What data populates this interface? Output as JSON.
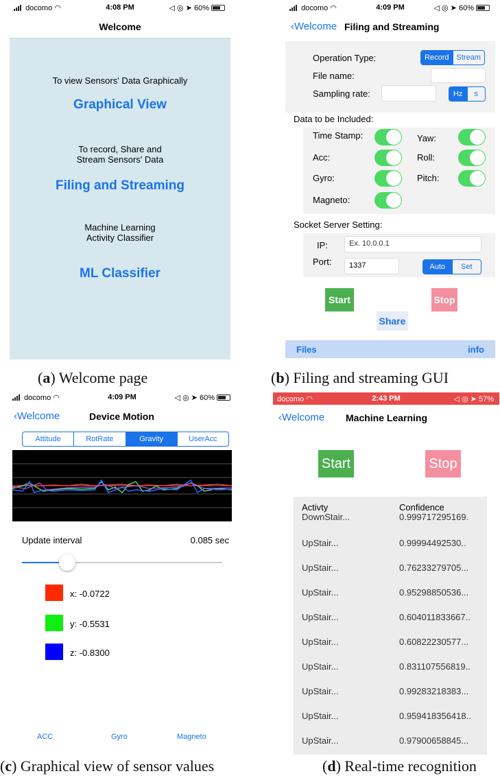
{
  "status_a": {
    "carrier": "docomo",
    "time": "4:08 PM",
    "battery": "60%"
  },
  "status_b": {
    "carrier": "docomo",
    "time": "4:09 PM",
    "battery": "60%"
  },
  "status_c": {
    "carrier": "docomo",
    "time": "4:09 PM",
    "battery": "60%"
  },
  "status_d": {
    "carrier": "docomo",
    "time": "2:43 PM",
    "battery": "57%"
  },
  "colors": {
    "accent": "#1a73e8",
    "switch_on": "#4cd964",
    "start": "#4caf50",
    "stop": "#f48fa0",
    "welcome_bg": "#d6e8ee",
    "status_red": "#e84a4a"
  },
  "welcome": {
    "title": "Welcome",
    "graphical_desc": "To view Sensors' Data Graphically",
    "graphical_button": "Graphical View",
    "filing_desc_1": "To record, Share and",
    "filing_desc_2": "Stream Sensors' Data",
    "filing_button": "Filing and Streaming",
    "ml_desc_1": "Machine Learning",
    "ml_desc_2": "Activity Classifier",
    "ml_button": "ML Classifier"
  },
  "filing": {
    "back": "Welcome",
    "title": "Filing and Streaming",
    "operation_label": "Operation Type:",
    "op_record": "Record",
    "op_stream": "Stream",
    "file_label": "File name:",
    "sampling_label": "Sampling rate:",
    "unit_hz": "Hz",
    "unit_s": "s",
    "data_label": "Data to be Included:",
    "timestamp": "Time Stamp:",
    "acc": "Acc:",
    "gyro": "Gyro:",
    "magneto": "Magneto:",
    "yaw": "Yaw:",
    "roll": "Roll:",
    "pitch": "Pitch:",
    "socket_label": "Socket Server Setting:",
    "ip_label": "IP:",
    "ip_placeholder": "Ex. 10.0.0.1",
    "port_label": "Port:",
    "port_value": "1337",
    "auto": "Auto",
    "set": "Set",
    "start": "Start",
    "stop": "Stop",
    "share": "Share",
    "files": "Files",
    "info": "info"
  },
  "graph": {
    "back": "Welcome",
    "title": "Device Motion",
    "tabs": [
      "Attitude",
      "RotRate",
      "Gravity",
      "UserAcc"
    ],
    "selected_tab": "Gravity",
    "interval_label": "Update interval",
    "interval_value": "0.085 sec",
    "slider_fraction": 0.2,
    "x": "x: -0.0722",
    "y": "y: -0.5531",
    "z": "z: -0.8300",
    "bottom_tabs": [
      "ACC",
      "Gyro",
      "Magneto"
    ]
  },
  "ml": {
    "back": "Welcome",
    "title": "Machine Learning",
    "start": "Start",
    "stop": "Stop",
    "col_activity": "Activty",
    "col_confidence": "Confidence",
    "rows": [
      {
        "activity": "DownStair...",
        "confidence": "0.999717295169."
      },
      {
        "activity": "UpStair...",
        "confidence": "0.99994492530.."
      },
      {
        "activity": "UpStair...",
        "confidence": "0.76233279705..."
      },
      {
        "activity": "UpStair...",
        "confidence": "0.95298850536..."
      },
      {
        "activity": "UpStair...",
        "confidence": "0.604011833667.."
      },
      {
        "activity": "UpStair...",
        "confidence": "0.60822230577..."
      },
      {
        "activity": "UpStair...",
        "confidence": "0.831107556819.."
      },
      {
        "activity": "UpStair...",
        "confidence": "0.99283218383..."
      },
      {
        "activity": "UpStair...",
        "confidence": "0.959418356418.."
      },
      {
        "activity": "UpStair...",
        "confidence": "0.97900658845..."
      }
    ]
  },
  "captions": {
    "a_label": "a",
    "a_text": ") Welcome page",
    "b_label": "b",
    "b_text": ") Filing and streaming GUI",
    "c_label": "c",
    "c_text": ") Graphical view of sensor values",
    "d_label": "d",
    "d_text": ") Real-time recognition"
  }
}
